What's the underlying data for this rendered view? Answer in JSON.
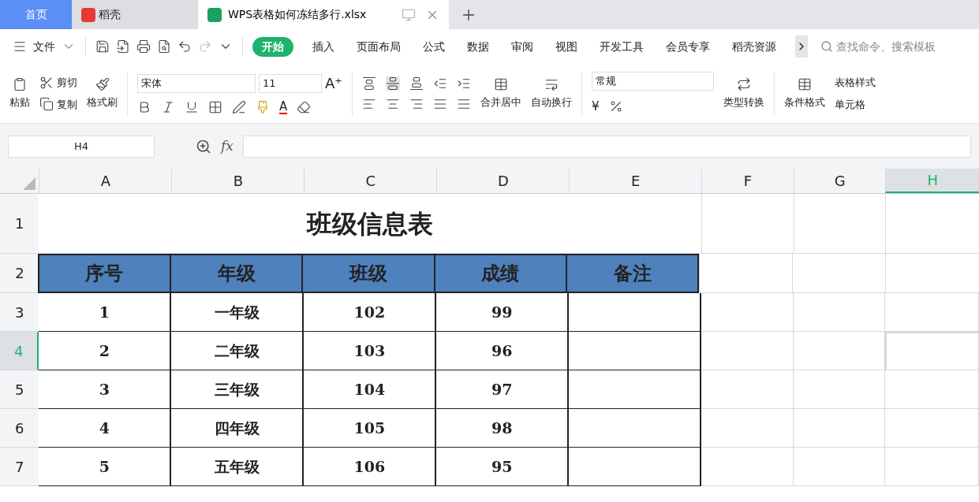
{
  "tabs": [
    {
      "label": "首页",
      "kind": "home",
      "selected": false
    },
    {
      "label": "稻壳",
      "kind": "docer",
      "selected": false
    },
    {
      "label": "WPS表格如何冻结多行.xlsx",
      "kind": "sheet",
      "selected": true
    }
  ],
  "menu": {
    "file": "文件",
    "tabs": [
      {
        "label": "开始",
        "selected": true
      },
      {
        "label": "插入",
        "selected": false
      },
      {
        "label": "页面布局",
        "selected": false
      },
      {
        "label": "公式",
        "selected": false
      },
      {
        "label": "数据",
        "selected": false
      },
      {
        "label": "审阅",
        "selected": false
      },
      {
        "label": "视图",
        "selected": false
      },
      {
        "label": "开发工具",
        "selected": false
      },
      {
        "label": "会员专享",
        "selected": false
      },
      {
        "label": "稻壳资源",
        "selected": false
      }
    ],
    "search_placeholder": "查找命令、搜索模板"
  },
  "ribbon": {
    "paste": "粘贴",
    "cut": "剪切",
    "copy": "复制",
    "format_painter": "格式刷",
    "font": "宋体",
    "font_size": "11",
    "merge": "合并居中",
    "wrap": "自动换行",
    "number_format": "常规",
    "convert": "类型转换",
    "conditional": "条件格式",
    "table_style": "表格样式",
    "cell_style": "单元格",
    "grow_font": "A⁺",
    "font_color": "A",
    "currency": "¥"
  },
  "formula_bar": {
    "name_box": "H4",
    "fx": "fx"
  },
  "columns": [
    {
      "label": "A",
      "selected": false
    },
    {
      "label": "B",
      "selected": false
    },
    {
      "label": "C",
      "selected": false
    },
    {
      "label": "D",
      "selected": false
    },
    {
      "label": "E",
      "selected": false
    },
    {
      "label": "F",
      "selected": false
    },
    {
      "label": "G",
      "selected": false
    },
    {
      "label": "H",
      "selected": true
    }
  ],
  "sheet": {
    "title": "班级信息表",
    "headers": [
      "序号",
      "年级",
      "班级",
      "成绩",
      "备注"
    ],
    "rows": [
      {
        "number": "3",
        "selected": false,
        "cells": [
          "1",
          "一年级",
          "102",
          "99"
        ]
      },
      {
        "number": "4",
        "selected": true,
        "cells": [
          "2",
          "二年级",
          "103",
          "96"
        ]
      },
      {
        "number": "5",
        "selected": false,
        "cells": [
          "3",
          "三年级",
          "104",
          "97"
        ]
      },
      {
        "number": "6",
        "selected": false,
        "cells": [
          "4",
          "四年级",
          "105",
          "98"
        ]
      },
      {
        "number": "7",
        "selected": false,
        "cells": [
          "5",
          "五年级",
          "106",
          "95"
        ]
      }
    ]
  },
  "row_numbers": [
    "1",
    "2"
  ]
}
